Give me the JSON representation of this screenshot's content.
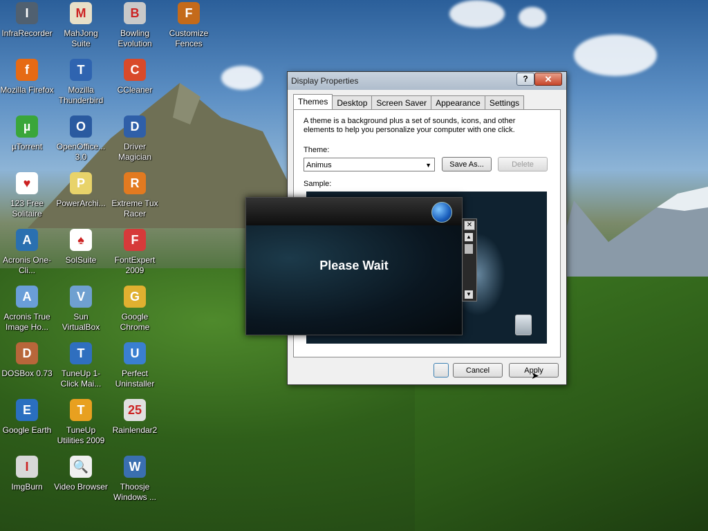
{
  "desktop_icons": [
    {
      "label": "InfraRecorder",
      "icon": "infrarecorder-icon",
      "color": "#506070",
      "glyph": "I"
    },
    {
      "label": "MahJong Suite",
      "icon": "mahjong-icon",
      "color": "#e8e0c8",
      "glyph": "M"
    },
    {
      "label": "Bowling Evolution",
      "icon": "bowling-icon",
      "color": "#c9c9c9",
      "glyph": "B"
    },
    {
      "label": "Customize Fences",
      "icon": "fences-icon",
      "color": "#c46a1a",
      "glyph": "F"
    },
    {
      "label": "Mozilla Firefox",
      "icon": "firefox-icon",
      "color": "#e66a14",
      "glyph": "f"
    },
    {
      "label": "Mozilla Thunderbird",
      "icon": "thunderbird-icon",
      "color": "#2f64b0",
      "glyph": "T"
    },
    {
      "label": "CCleaner",
      "icon": "ccleaner-icon",
      "color": "#d94a2a",
      "glyph": "C"
    },
    {
      "label": "µTorrent",
      "icon": "utorrent-icon",
      "color": "#3aa63a",
      "glyph": "µ"
    },
    {
      "label": "OpenOffice... 3.0",
      "icon": "openoffice-icon",
      "color": "#2a5aa0",
      "glyph": "O"
    },
    {
      "label": "Driver Magician",
      "icon": "driver-magician-icon",
      "color": "#2f5fa8",
      "glyph": "D"
    },
    {
      "label": "123 Free Solitaire",
      "icon": "solitaire-icon",
      "color": "#ffffff",
      "glyph": "♥"
    },
    {
      "label": "PowerArchi...",
      "icon": "powerarchiver-icon",
      "color": "#e8d36a",
      "glyph": "P"
    },
    {
      "label": "Extreme Tux Racer",
      "icon": "tux-racer-icon",
      "color": "#e27a20",
      "glyph": "R"
    },
    {
      "label": "Acronis One-Cli...",
      "icon": "acronis-icon",
      "color": "#2a70b0",
      "glyph": "A"
    },
    {
      "label": "SolSuite",
      "icon": "solsuite-icon",
      "color": "#ffffff",
      "glyph": "♠"
    },
    {
      "label": "FontExpert 2009",
      "icon": "fontexpert-icon",
      "color": "#d63a3a",
      "glyph": "F"
    },
    {
      "label": "Acronis True Image Ho...",
      "icon": "acronis-true-image-icon",
      "color": "#6a9ed8",
      "glyph": "A"
    },
    {
      "label": "Sun VirtualBox",
      "icon": "virtualbox-icon",
      "color": "#6fa0d0",
      "glyph": "V"
    },
    {
      "label": "Google Chrome",
      "icon": "chrome-icon",
      "color": "#e0b030",
      "glyph": "G"
    },
    {
      "label": "DOSBox 0.73",
      "icon": "dosbox-icon",
      "color": "#b8663a",
      "glyph": "D"
    },
    {
      "label": "TuneUp 1-Click Mai...",
      "icon": "tuneup-1click-icon",
      "color": "#2f6fbf",
      "glyph": "T"
    },
    {
      "label": "Perfect Uninstaller",
      "icon": "perfect-uninstaller-icon",
      "color": "#3a7fd0",
      "glyph": "U"
    },
    {
      "label": "Google Earth",
      "icon": "google-earth-icon",
      "color": "#2a6fc0",
      "glyph": "E"
    },
    {
      "label": "TuneUp Utilities 2009",
      "icon": "tuneup-utilities-icon",
      "color": "#e8a020",
      "glyph": "T"
    },
    {
      "label": "Rainlendar2",
      "icon": "rainlendar-icon",
      "color": "#e0e0e0",
      "glyph": "25"
    },
    {
      "label": "ImgBurn",
      "icon": "imgburn-icon",
      "color": "#d8d8d8",
      "glyph": "I"
    },
    {
      "label": "Video Browser",
      "icon": "video-browser-icon",
      "color": "#f0f0f0",
      "glyph": "🔍"
    },
    {
      "label": "Thoosje Windows ...",
      "icon": "thoosje-icon",
      "color": "#3a6fb0",
      "glyph": "W"
    }
  ],
  "dialog": {
    "title": "Display Properties",
    "help": "?",
    "close": "✕",
    "tabs": [
      "Themes",
      "Desktop",
      "Screen Saver",
      "Appearance",
      "Settings"
    ],
    "description": "A theme is a background plus a set of sounds, icons, and other elements to help you personalize your computer with one click.",
    "theme_label": "Theme:",
    "theme_value": "Animus",
    "save_as": "Save As...",
    "delete": "Delete",
    "sample_label": "Sample:",
    "cancel": "Cancel",
    "apply": "Apply"
  },
  "wait_dialog": {
    "message": "Please Wait"
  },
  "mini_scroll": {
    "close": "✕",
    "up": "▲",
    "down": "▼"
  }
}
